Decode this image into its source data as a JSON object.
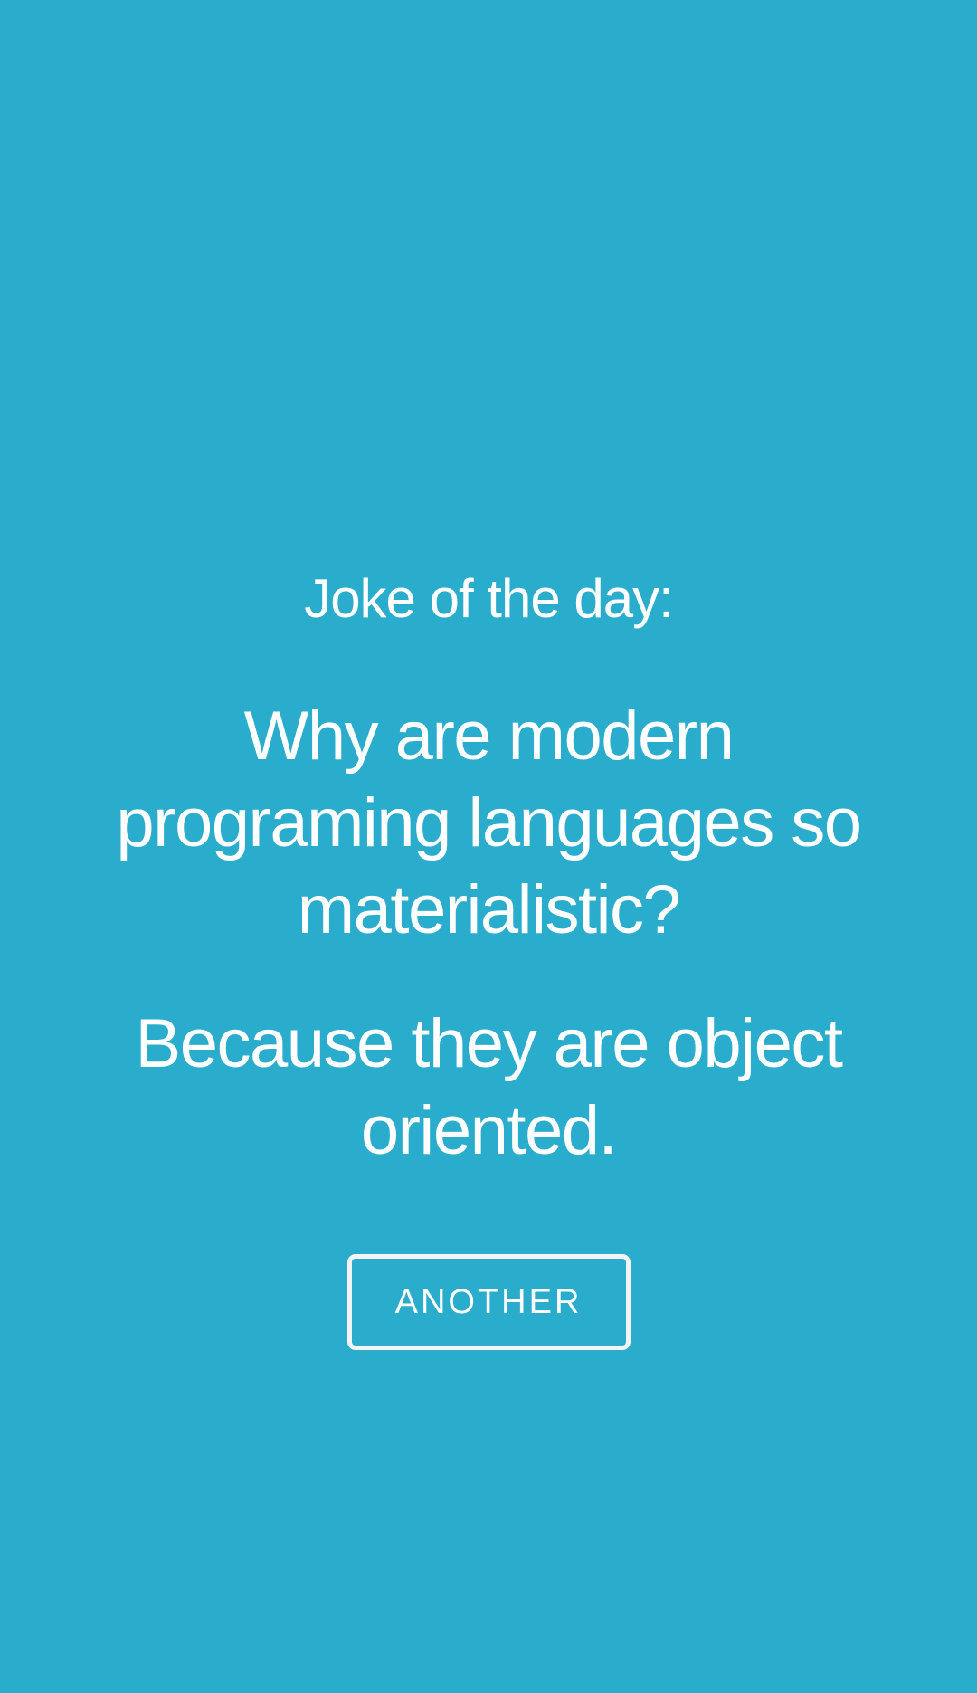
{
  "joke": {
    "heading": "Joke of the day:",
    "question": "Why are modern programing languages so materialistic?",
    "answer": "Because they are object oriented."
  },
  "actions": {
    "another_label": "ANOTHER"
  },
  "colors": {
    "background": "#2aaccc",
    "text": "#ffffff",
    "button_border": "#f4f4f4"
  }
}
